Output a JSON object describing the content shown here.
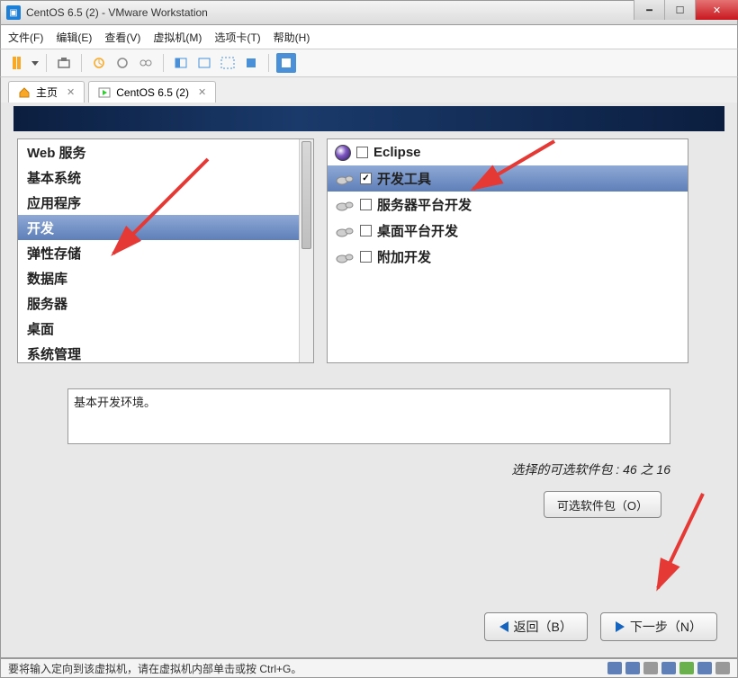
{
  "window": {
    "title": "CentOS 6.5 (2) - VMware Workstation"
  },
  "menu": {
    "file": "文件(F)",
    "edit": "编辑(E)",
    "view": "查看(V)",
    "vm": "虚拟机(M)",
    "tabs": "选项卡(T)",
    "help": "帮助(H)"
  },
  "tabs": {
    "home": "主页",
    "vm": "CentOS 6.5 (2)"
  },
  "categories": [
    "Web 服务",
    "基本系统",
    "应用程序",
    "开发",
    "弹性存储",
    "数据库",
    "服务器",
    "桌面",
    "系统管理"
  ],
  "selected_category_index": 3,
  "packages": [
    {
      "label": "Eclipse",
      "checked": false,
      "icon": "eclipse"
    },
    {
      "label": "开发工具",
      "checked": true,
      "icon": "foot"
    },
    {
      "label": "服务器平台开发",
      "checked": false,
      "icon": "foot"
    },
    {
      "label": "桌面平台开发",
      "checked": false,
      "icon": "foot"
    },
    {
      "label": "附加开发",
      "checked": false,
      "icon": "foot"
    }
  ],
  "selected_package_index": 1,
  "description": "基本开发环境。",
  "pkgcount": {
    "prefix": "选择",
    "mid": "的可选软件包 : ",
    "total": "46",
    "sep": " 之 ",
    "selected": "16"
  },
  "buttons": {
    "optional": "可选软件包（O）",
    "back": "返回（B）",
    "next": "下一步（N）"
  },
  "status": "要将输入定向到该虚拟机，请在虚拟机内部单击或按 Ctrl+G。"
}
